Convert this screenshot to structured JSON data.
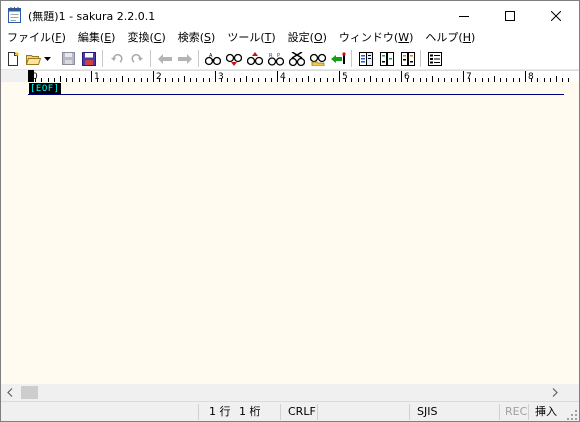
{
  "window": {
    "title": "(無題)1 - sakura 2.2.0.1",
    "icon": "notepad-icon"
  },
  "menu": [
    {
      "label": "ファイル(",
      "acc": "F",
      "tail": ")"
    },
    {
      "label": "編集(",
      "acc": "E",
      "tail": ")"
    },
    {
      "label": "変換(",
      "acc": "C",
      "tail": ")"
    },
    {
      "label": "検索(",
      "acc": "S",
      "tail": ")"
    },
    {
      "label": "ツール(",
      "acc": "T",
      "tail": ")"
    },
    {
      "label": "設定(",
      "acc": "O",
      "tail": ")"
    },
    {
      "label": "ウィンドウ(",
      "acc": "W",
      "tail": ")"
    },
    {
      "label": "ヘルプ(",
      "acc": "H",
      "tail": ")"
    }
  ],
  "ruler": {
    "numbers": [
      "0",
      "1",
      "2",
      "3",
      "4",
      "5",
      "6",
      "7",
      "8"
    ]
  },
  "editor": {
    "eof_marker": "[EOF]",
    "background": "#fffbf0"
  },
  "status": {
    "row": "1 行",
    "col": "1 桁",
    "line_ending": "CRLF",
    "encoding": "SJIS",
    "rec": "REC",
    "insert_mode": "挿入"
  }
}
